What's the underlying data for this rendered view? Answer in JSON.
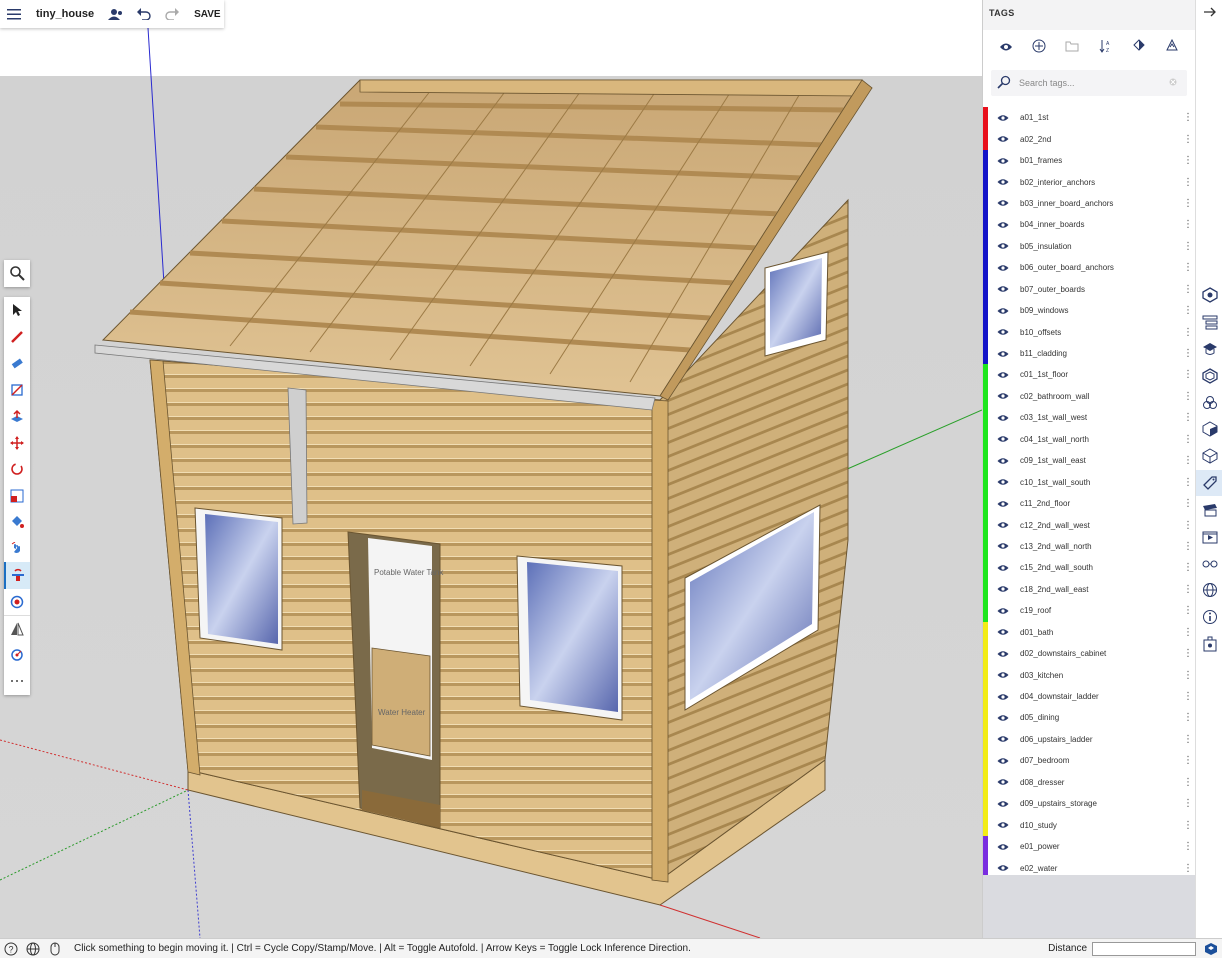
{
  "topbar": {
    "menu_icon": "hamburger-menu-icon",
    "title": "tiny_house",
    "save_label": "SAVE"
  },
  "scene": {
    "label_water_tank": "Potable Water Tank",
    "label_water_heater": "Water Heater"
  },
  "tools": [
    "select-tool",
    "pencil-tool",
    "eraser-tool",
    "line-tool",
    "push-pull-tool",
    "move-tool",
    "rotate-tool",
    "scale-tool",
    "paint-bucket-tool",
    "orbit-tool",
    "move-tool-active",
    "tape-measure-tool",
    "section-plane-tool",
    "position-camera-tool",
    "more-tools"
  ],
  "panel": {
    "title": "TAGS",
    "search_placeholder": "Search tags...",
    "tags": [
      {
        "name": "a01_1st",
        "color": "#e8101c"
      },
      {
        "name": "a02_2nd",
        "color": "#e8101c"
      },
      {
        "name": "b01_frames",
        "color": "#1414c8"
      },
      {
        "name": "b02_interior_anchors",
        "color": "#1414c8"
      },
      {
        "name": "b03_inner_board_anchors",
        "color": "#1414c8"
      },
      {
        "name": "b04_inner_boards",
        "color": "#1414c8"
      },
      {
        "name": "b05_insulation",
        "color": "#1414c8"
      },
      {
        "name": "b06_outer_board_anchors",
        "color": "#1414c8"
      },
      {
        "name": "b07_outer_boards",
        "color": "#1414c8"
      },
      {
        "name": "b09_windows",
        "color": "#1414c8"
      },
      {
        "name": "b10_offsets",
        "color": "#1414c8"
      },
      {
        "name": "b11_cladding",
        "color": "#1414c8"
      },
      {
        "name": "c01_1st_floor",
        "color": "#1ee61e"
      },
      {
        "name": "c02_bathroom_wall",
        "color": "#1ee61e"
      },
      {
        "name": "c03_1st_wall_west",
        "color": "#1ee61e"
      },
      {
        "name": "c04_1st_wall_north",
        "color": "#1ee61e"
      },
      {
        "name": "c09_1st_wall_east",
        "color": "#1ee61e"
      },
      {
        "name": "c10_1st_wall_south",
        "color": "#1ee61e"
      },
      {
        "name": "c11_2nd_floor",
        "color": "#1ee61e"
      },
      {
        "name": "c12_2nd_wall_west",
        "color": "#1ee61e"
      },
      {
        "name": "c13_2nd_wall_north",
        "color": "#1ee61e"
      },
      {
        "name": "c15_2nd_wall_south",
        "color": "#1ee61e"
      },
      {
        "name": "c18_2nd_wall_east",
        "color": "#1ee61e"
      },
      {
        "name": "c19_roof",
        "color": "#1ee61e"
      },
      {
        "name": "d01_bath",
        "color": "#f2ec16"
      },
      {
        "name": "d02_downstairs_cabinet",
        "color": "#f2ec16"
      },
      {
        "name": "d03_kitchen",
        "color": "#f2ec16"
      },
      {
        "name": "d04_downstair_ladder",
        "color": "#f2ec16"
      },
      {
        "name": "d05_dining",
        "color": "#f2ec16"
      },
      {
        "name": "d06_upstairs_ladder",
        "color": "#f2ec16"
      },
      {
        "name": "d07_bedroom",
        "color": "#f2ec16"
      },
      {
        "name": "d08_dresser",
        "color": "#f2ec16"
      },
      {
        "name": "d09_upstairs_storage",
        "color": "#f2ec16"
      },
      {
        "name": "d10_study",
        "color": "#f2ec16"
      },
      {
        "name": "e01_power",
        "color": "#7a2ee0"
      },
      {
        "name": "e02_water",
        "color": "#7a2ee0"
      }
    ]
  },
  "status": {
    "message": "Click something to begin moving it. | Ctrl = Cycle Copy/Stamp/Move. | Alt = Toggle Autofold. | Arrow Keys = Toggle Lock Inference Direction.",
    "measure_label": "Distance",
    "measure_value": ""
  }
}
